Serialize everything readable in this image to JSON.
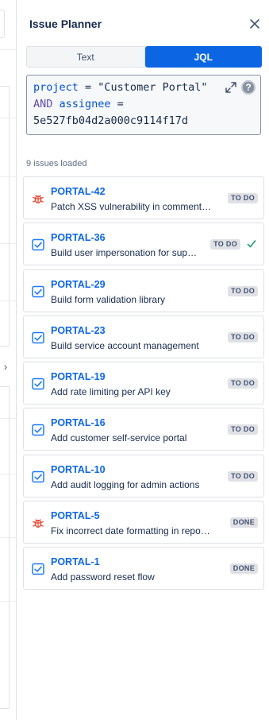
{
  "panel": {
    "title": "Issue Planner",
    "close_icon": "close-icon"
  },
  "toggle": {
    "text_label": "Text",
    "jql_label": "JQL",
    "active": "JQL"
  },
  "jql": {
    "line1_kw": "project",
    "line1_op": " = ",
    "line1_value": "\"Customer Portal\"",
    "line2_and": "AND",
    "line2_field": " assignee",
    "line2_op": " =",
    "line3_value": "5e527fb04d2a000c9114f17d",
    "expand_icon": "expand-icon",
    "help_icon": "help-icon",
    "help_glyph": "?"
  },
  "issues_count": "9 issues loaded",
  "colors": {
    "accent": "#0c66e4",
    "bug": "#e34935",
    "story": "#1d7afc",
    "check": "#22a06b"
  },
  "issues": [
    {
      "key": "PORTAL-42",
      "summary": "Patch XSS vulnerability in comment…",
      "status": "TO DO",
      "type_icon": "bug-icon"
    },
    {
      "key": "PORTAL-36",
      "summary": "Build user impersonation for sup…",
      "status": "TO DO",
      "type_icon": "task-icon",
      "selected_icon": "check-icon"
    },
    {
      "key": "PORTAL-29",
      "summary": "Build form validation library",
      "status": "TO DO",
      "type_icon": "task-icon"
    },
    {
      "key": "PORTAL-23",
      "summary": "Build service account management",
      "status": "TO DO",
      "type_icon": "task-icon"
    },
    {
      "key": "PORTAL-19",
      "summary": "Add rate limiting per API key",
      "status": "TO DO",
      "type_icon": "task-icon"
    },
    {
      "key": "PORTAL-16",
      "summary": "Add customer self-service portal",
      "status": "TO DO",
      "type_icon": "task-icon"
    },
    {
      "key": "PORTAL-10",
      "summary": "Add audit logging for admin actions",
      "status": "TO DO",
      "type_icon": "task-icon"
    },
    {
      "key": "PORTAL-5",
      "summary": "Fix incorrect date formatting in repo…",
      "status": "DONE",
      "type_icon": "bug-icon"
    },
    {
      "key": "PORTAL-1",
      "summary": "Add password reset flow",
      "status": "DONE",
      "type_icon": "task-icon"
    }
  ],
  "sidebar_toggle_glyph": "›"
}
